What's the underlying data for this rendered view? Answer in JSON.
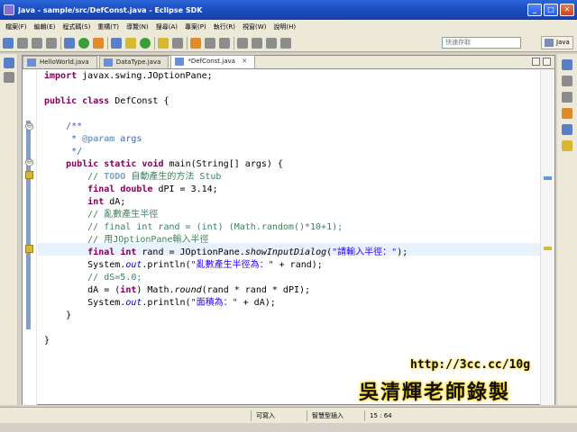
{
  "window": {
    "title": "Java - sample/src/DefConst.java - Eclipse SDK"
  },
  "menu": [
    "檔案(F)",
    "編輯(E)",
    "程式碼(S)",
    "重構(T)",
    "導覽(N)",
    "搜尋(A)",
    "專案(P)",
    "執行(R)",
    "視窗(W)",
    "說明(H)"
  ],
  "toolbar": {
    "search_placeholder": "快速存取",
    "perspective_label": "Java"
  },
  "tabs": [
    {
      "label": "HelloWorld.java"
    },
    {
      "label": "DataType.java"
    },
    {
      "label": "*DefConst.java",
      "close": "✕"
    }
  ],
  "code": {
    "l1_kw": "import",
    "l1_rest": " javax.swing.JOptionPane;",
    "l2_kw1": "public",
    "l2_kw2": "class",
    "l2_rest": " DefConst {",
    "l3": "    /**",
    "l4_star": "     * ",
    "l4_tag": "@param",
    "l4_rest": " args",
    "l5": "     */",
    "l6_kw1": "public",
    "l6_kw2": "static",
    "l6_kw3": "void",
    "l6_rest": " main(String[] args) {",
    "l7_pre": "        // ",
    "l7_todo": "TODO",
    "l7_rest": " 自動產生的方法 Stub",
    "l8_kw1": "final",
    "l8_kw2": "double",
    "l8_rest": " dPI = 3.14;",
    "l9_kw": "int",
    "l9_rest": " dA;",
    "l10": "        // 亂數產生半徑",
    "l11": "        // final int rand = (int) (Math.random()*10+1);",
    "l12": "        // 用JOptionPane輸入半徑",
    "l13_kw1": "final",
    "l13_kw2": "int",
    "l13_mid": " rand = JOptionPane.",
    "l13_meth": "showInputDialog",
    "l13_open": "(",
    "l13_str": "\"請輸入半徑：\"",
    "l13_end": ");",
    "l14_pre": "        System.",
    "l14_fld": "out",
    "l14_mid": ".println(",
    "l14_str": "\"亂數產生半徑為：\"",
    "l14_end": " + rand);",
    "l15": "        // dS=5.0;",
    "l16_pre": "        dA = (",
    "l16_kw": "int",
    "l16_mid": ") Math.",
    "l16_meth": "round",
    "l16_end": "(rand * rand * dPI);",
    "l17_pre": "        System.",
    "l17_fld": "out",
    "l17_mid": ".println(",
    "l17_str": "\"面積為：\"",
    "l17_end": " + dA);",
    "l18": "    }",
    "l19": "}"
  },
  "watermark": {
    "url": "http://3cc.cc/10g",
    "name": "吳清輝老師錄製"
  },
  "status": {
    "writable": "可寫入",
    "insert_mode": "智慧型插入",
    "position": "15 : 64"
  }
}
